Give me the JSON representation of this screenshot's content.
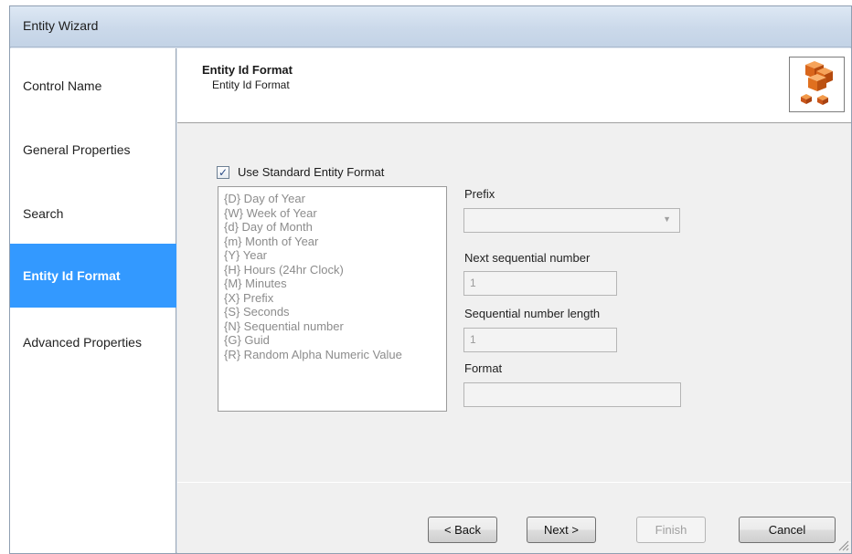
{
  "window": {
    "title": "Entity Wizard"
  },
  "sidebar": {
    "items": [
      {
        "label": "Control Name",
        "active": false
      },
      {
        "label": "General Properties",
        "active": false
      },
      {
        "label": "Search",
        "active": false
      },
      {
        "label": "Entity Id Format",
        "active": true
      },
      {
        "label": "Advanced Properties",
        "active": false
      }
    ]
  },
  "header": {
    "title": "Entity Id Format",
    "subtitle": "Entity Id Format",
    "logo_icon": "orange-cubes-icon"
  },
  "form": {
    "use_standard": {
      "label": "Use Standard Entity Format",
      "checked": true
    },
    "tokens": [
      "{D} Day of Year",
      "{W} Week of Year",
      "{d} Day of Month",
      "{m} Month of Year",
      "{Y} Year",
      "{H} Hours (24hr Clock)",
      "{M} Minutes",
      "{X} Prefix",
      "{S} Seconds",
      "{N} Sequential number",
      "{G} Guid",
      "{R} Random Alpha Numeric Value"
    ],
    "prefix": {
      "label": "Prefix",
      "value": ""
    },
    "next_sequential": {
      "label": "Next sequential number",
      "value": "1"
    },
    "sequential_length": {
      "label": "Sequential number length",
      "value": "1"
    },
    "format": {
      "label": "Format",
      "value": ""
    }
  },
  "buttons": {
    "back": "< Back",
    "next": "Next >",
    "finish": "Finish",
    "cancel": "Cancel"
  },
  "colors": {
    "active_nav": "#3399ff",
    "title_bar": "#cbd9ea",
    "panel": "#f0f0f0"
  }
}
